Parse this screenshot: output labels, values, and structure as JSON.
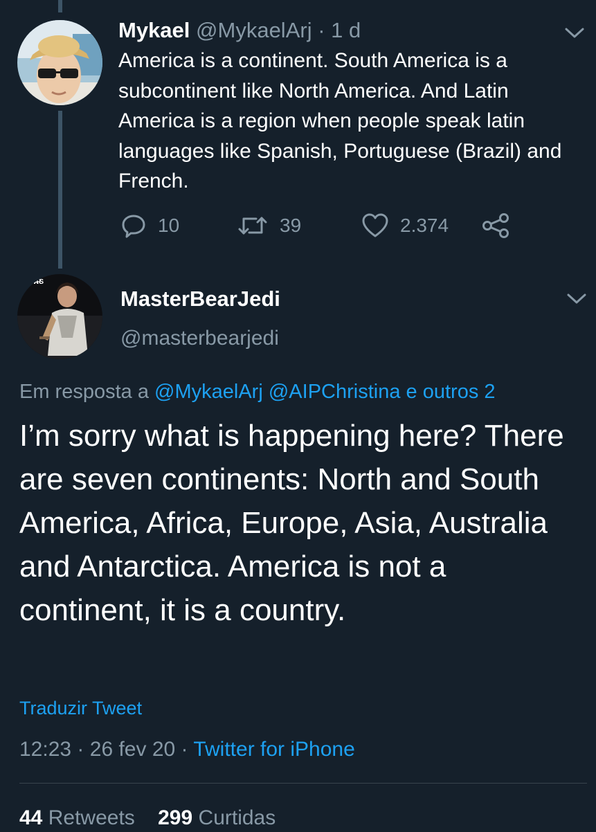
{
  "colors": {
    "background": "#15202b",
    "secondary_text": "#8899a6",
    "link": "#1da1f2",
    "thread_line": "#3d5466"
  },
  "tweet1": {
    "display_name": "Mykael",
    "handle": "@MykaelArj",
    "separator": "·",
    "time": "1 d",
    "text": "America is a continent. South America is a subcontinent like North America. And Latin America is a region when people speak latin languages like Spanish, Portuguese (Brazil) and French.",
    "actions": {
      "reply_icon": "reply-icon",
      "reply_count": "10",
      "retweet_icon": "retweet-icon",
      "retweet_count": "39",
      "like_icon": "heart-icon",
      "like_count": "2.374",
      "share_icon": "share-icon"
    }
  },
  "tweet2": {
    "display_name": "MasterBearJedi",
    "handle": "@masterbearjedi",
    "avatar_text": "STAR WARS",
    "reply_prefix": "Em resposta a",
    "reply_mention_1": "@MykaelArj",
    "reply_mention_2": "@AIPChristina",
    "reply_others": "e outros 2",
    "text": "I’m sorry what is happening here? There are seven continents: North and South America, Africa, Europe, Asia, Australia and Antarctica. America is not a continent, it is a country.",
    "translate_label": "Traduzir Tweet",
    "time": "12:23",
    "separator": "·",
    "date": "26 fev 20",
    "source": "Twitter for iPhone",
    "retweet_count": "44",
    "retweet_label": "Retweets",
    "like_count": "299",
    "like_label": "Curtidas"
  }
}
